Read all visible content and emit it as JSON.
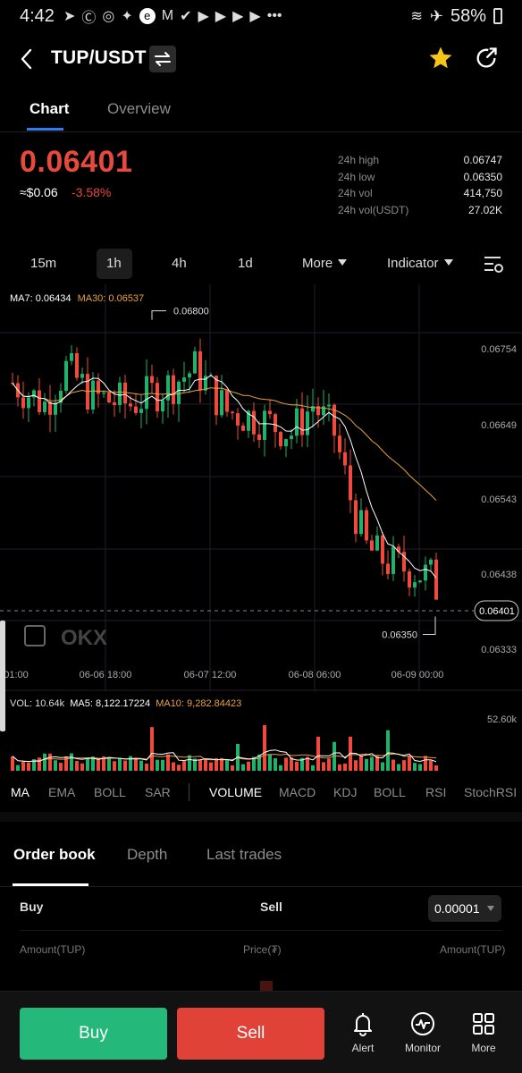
{
  "status_bar": {
    "time": "4:42",
    "battery": "58%"
  },
  "header": {
    "pair": "TUP/USDT"
  },
  "tabs": [
    {
      "label": "Chart",
      "active": true
    },
    {
      "label": "Overview",
      "active": false
    }
  ],
  "ticker": {
    "last_price": "0.06401",
    "approx_usd": "≈$0.06",
    "change_pct": "-3.58%",
    "stats": [
      {
        "label": "24h high",
        "value": "0.06747"
      },
      {
        "label": "24h low",
        "value": "0.06350"
      },
      {
        "label": "24h vol",
        "value": "414,750"
      },
      {
        "label": "24h vol(USDT)",
        "value": "27.02K"
      }
    ]
  },
  "intervals": {
    "items": [
      "15m",
      "1h",
      "4h",
      "1d"
    ],
    "active": "1h",
    "more_label": "More",
    "indicator_label": "Indicator"
  },
  "chart_legend": {
    "ma7": "MA7: 0.06434",
    "ma30": "MA30: 0.06537",
    "vol": "VOL: 10.64k",
    "ma5": "MA5: 8,122.17224",
    "ma10": "MA10: 9,282.84423"
  },
  "chart_data": {
    "type": "candlestick",
    "y_ticks": [
      "0.06754",
      "0.06649",
      "0.06543",
      "0.06438",
      "0.06333"
    ],
    "ylim": [
      0.06312,
      0.06822
    ],
    "x_ticks": [
      "01:00",
      "06-06 18:00",
      "06-07 12:00",
      "06-08 06:00",
      "06-09 00:00"
    ],
    "current_price_label": "0.06401",
    "high_marker": "0.06800",
    "low_marker": "0.06350",
    "volume_axis_max": "52.60k",
    "watermark": "OKX",
    "colors": {
      "up": "#20b26c",
      "down": "#ef4a3d",
      "ma7": "#ffffff",
      "ma30": "#e8a33d"
    }
  },
  "indicator_tabs": {
    "main": [
      "MA",
      "EMA",
      "BOLL",
      "SAR"
    ],
    "sub": [
      "VOLUME",
      "MACD",
      "KDJ",
      "BOLL",
      "RSI",
      "StochRSI"
    ],
    "active_sub": "VOLUME"
  },
  "orderbook": {
    "tabs": [
      "Order book",
      "Depth",
      "Last trades"
    ],
    "active_tab": "Order book",
    "buy_label": "Buy",
    "sell_label": "Sell",
    "precision": "0.00001",
    "col_amount_left": "Amount(TUP)",
    "col_price": "Price(₮)",
    "col_amount_right": "Amount(TUP)"
  },
  "bottom_bar": {
    "buy": "Buy",
    "sell": "Sell",
    "alert": "Alert",
    "monitor": "Monitor",
    "more": "More"
  }
}
